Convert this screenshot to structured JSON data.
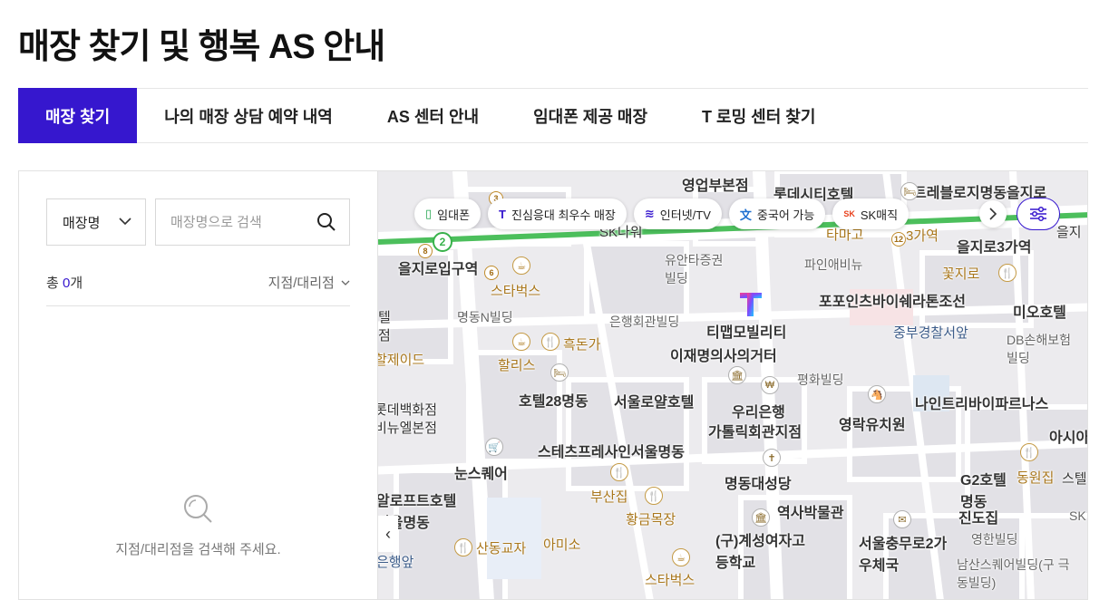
{
  "page": {
    "title": "매장 찾기 및 행복 AS 안내"
  },
  "tabs": [
    {
      "label": "매장 찾기",
      "active": true
    },
    {
      "label": "나의 매장 상담 예약 내역",
      "active": false
    },
    {
      "label": "AS 센터 안내",
      "active": false
    },
    {
      "label": "임대폰 제공 매장",
      "active": false
    },
    {
      "label": "T 로밍 센터 찾기",
      "active": false
    }
  ],
  "search": {
    "select_value": "매장명",
    "placeholder": "매장명으로 검색",
    "search_icon": "search-icon"
  },
  "results": {
    "count_prefix": "총 ",
    "count": "0",
    "count_suffix": "개",
    "sort_label": "지점/대리점",
    "empty_message": "지점/대리점을 검색해 주세요."
  },
  "map": {
    "filter_chips": [
      {
        "icon": "phone-icon",
        "label": "임대폰",
        "color": "#1ea34c"
      },
      {
        "icon": "t-icon",
        "label": "진심응대 최우수 매장",
        "color": "#3617ce"
      },
      {
        "icon": "wifi-icon",
        "label": "인터넷/TV",
        "color": "#3617ce"
      },
      {
        "icon": "language-icon",
        "label": "중국어 가능",
        "color": "#1e6fd0"
      },
      {
        "icon": "sk-icon",
        "label": "SK매직",
        "color": "#e8401c"
      }
    ],
    "labels": [
      "영업부본점",
      "롯데시티호텔",
      "트레블로지명동을지로",
      "을지로3가역",
      "을지로입구역",
      "스타벅스",
      "유안타증권빌딩",
      "파인애비뉴",
      "꽃지로",
      "명동N빌딩",
      "은행회관빌딩",
      "포포인츠바이쉐라톤조선",
      "미오호텔",
      "티맵모빌리티",
      "중부경찰서앞",
      "흑돈가",
      "이재명의사의거터",
      "DB손해보험빌딩",
      "할리스",
      "호텔28명동",
      "서울로얄호텔",
      "평화빌딩",
      "우리은행",
      "가톨릭회관지점",
      "나인트리바이파르나스",
      "영락유치원",
      "스테츠프레사인서울명동",
      "눈스퀘어",
      "명동대성당",
      "아시아",
      "G2호텔명동",
      "동원집",
      "부산집",
      "황금목장",
      "역사박물관",
      "진도집",
      "알로프트호텔서울명동",
      "산동교자",
      "아미소",
      "(구)계성여자고등학교",
      "서울충무로2가우체국",
      "영한빌딩",
      "남산스퀘어빌딩(구 극동빌딩)",
      "스타벅스",
      "은행앞",
      "SK나워",
      "타마고",
      "3가역",
      "을지",
      "롯데백화점",
      "비뉴엘본점",
      "할제이드",
      "텔",
      "점",
      "SK",
      "스텔"
    ]
  },
  "colors": {
    "accent": "#3617ce",
    "subway_line2": "#38b24b"
  }
}
